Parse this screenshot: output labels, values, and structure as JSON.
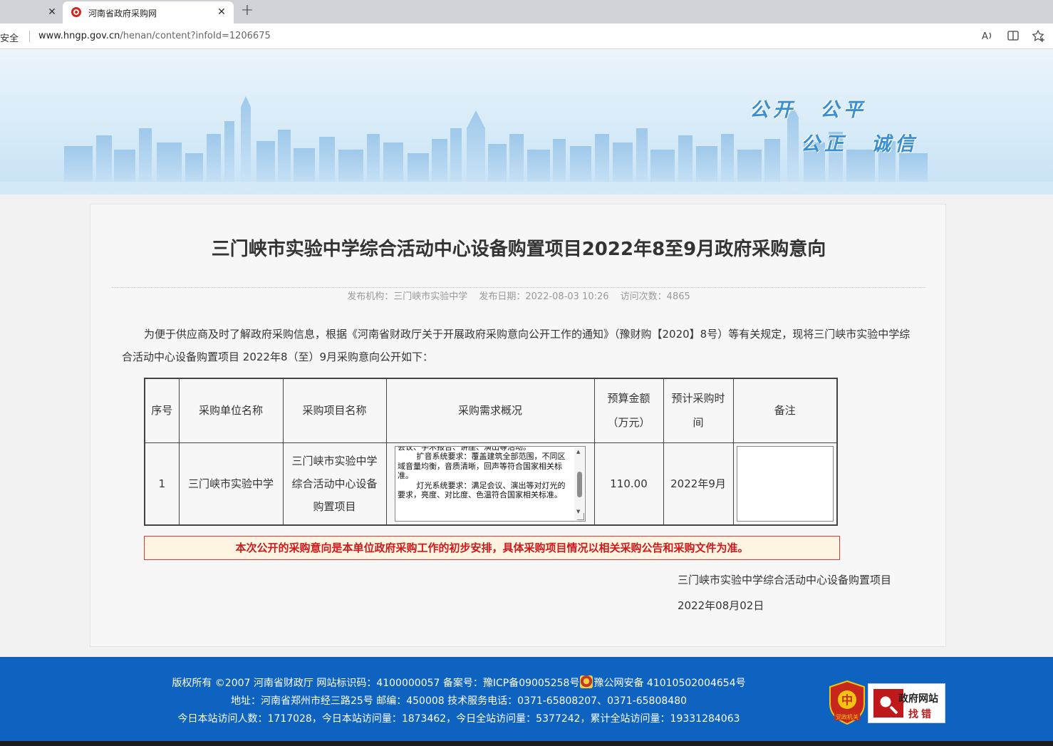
{
  "browser": {
    "prev_tab_close": "✕",
    "active_tab_title": "河南省政府采购网",
    "active_tab_close": "✕",
    "new_tab": "+",
    "security_label": "安全",
    "url_host": "www.hngp.gov.cn",
    "url_path": "/henan/content?infoId=1206675",
    "icons": [
      "read-aloud-icon",
      "split-screen-icon",
      "favorites-icon"
    ]
  },
  "banner": {
    "slogan_line1": "公开　公平",
    "slogan_line2": "公正　诚信"
  },
  "article": {
    "title": "三门峡市实验中学综合活动中心设备购置项目2022年8至9月政府采购意向",
    "meta": {
      "publisher": "发布机构：三门峡市实验中学",
      "publish_date": "发布日期：2022-08-03 10:26",
      "visits": "访问次数：4865"
    },
    "intro": "为便于供应商及时了解政府采购信息，根据《河南省财政厅关于开展政府采购意向公开工作的通知》（豫财购【2020】8号）等有关规定，现将三门峡市实验中学综合活动中心设备购置项目 2022年8（至）9月采购意向公开如下：",
    "table": {
      "headers": {
        "seq": "序号",
        "unit": "采购单位名称",
        "project": "采购项目名称",
        "needs": "采购需求概况",
        "budget_line1": "预算金额",
        "budget_line2": "（万元）",
        "time_line1": "预计采购时",
        "time_line2": "间",
        "remark": "备注"
      },
      "row": {
        "seq": "1",
        "unit": "三门峡市实验中学",
        "project": "三门峡市实验中学综合活动中心设备购置项目",
        "needs": "会议、学术报告、讲座、演出等活动。\n    扩音系统要求：覆盖建筑全部范围，不同区域音量均衡，音质清晰，回声等符合国家相关标准。\n    灯光系统要求：满足会议、演出等对灯光的要求，亮度、对比度、色温符合国家相关标准。",
        "budget": "110.00",
        "time": "2022年9月",
        "remark": ""
      }
    },
    "notice": "本次公开的采购意向是本单位政府采购工作的初步安排，具体采购项目情况以相关采购公告和采购文件为准。",
    "sign_unit": "三门峡市实验中学综合活动中心设备购置项目",
    "sign_date": "2022年08月02日"
  },
  "footer": {
    "line1_a": "版权所有 ©2007 河南省财政厅 网站标识码：4100000057 备案号：豫ICP备09005258号",
    "line1_b": "豫公网安备 41010502004654号",
    "line2": "地址：河南省郑州市经三路25号 邮编：450008 技术服务电话：0371-65808207、0371-65808480",
    "line3": "今日本站访问人数：1717028，今日本站访问量：1873462，今日全站访问量：5377242，累计全站访问量：19331284063",
    "badge_label": "党政机关",
    "jiucuo_line1": "政府网站",
    "jiucuo_line2": "找错"
  }
}
